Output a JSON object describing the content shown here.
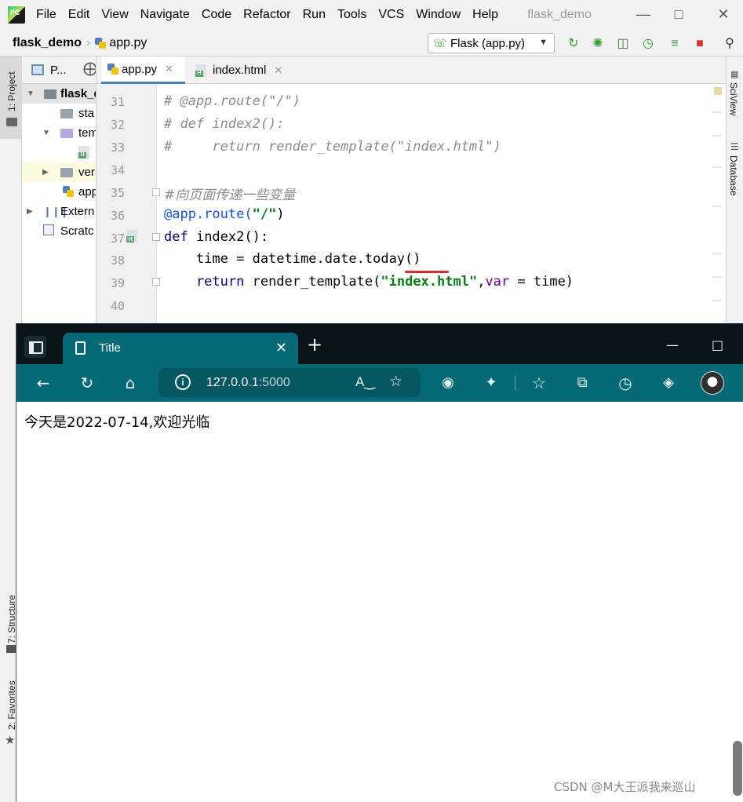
{
  "ide": {
    "menu": [
      "File",
      "Edit",
      "View",
      "Navigate",
      "Code",
      "Refactor",
      "Run",
      "Tools",
      "VCS",
      "Window",
      "Help"
    ],
    "window_title": "flask_demo",
    "breadcrumb": {
      "project": "flask_demo",
      "file": "app.py"
    },
    "run_config": "Flask (app.py)",
    "left_strip": {
      "project": "1: Project",
      "structure": "7: Structure",
      "favorites": "2: Favorites"
    },
    "right_strip": {
      "sciview": "SciView",
      "database": "Database"
    },
    "project_panel": {
      "header": "P...",
      "tree": [
        "flask_d",
        "sta",
        "tem",
        "",
        "ver",
        "app",
        "Extern",
        "Scratc"
      ]
    },
    "tabs": [
      {
        "label": "app.py",
        "active": true
      },
      {
        "label": "index.html",
        "active": false
      }
    ],
    "code": {
      "line_numbers": [
        "31",
        "32",
        "33",
        "34",
        "35",
        "36",
        "37",
        "38",
        "39",
        "40"
      ],
      "l31": "# @app.route(\"/\")",
      "l32": "# def index2():",
      "l33": "#     return render_template(\"index.html\")",
      "l35": "#向页面传递一些变量",
      "l36a": "@app.route(",
      "l36b": "\"/\"",
      "l36c": ")",
      "l37a": "def",
      "l37b": " index2():",
      "l38": "    time = datetime.date.today()",
      "l39a": "    return",
      "l39b": " render_template(",
      "l39c": "\"index.html\"",
      "l39d": ",",
      "l39e": "var",
      "l39f": " = time)"
    }
  },
  "browser": {
    "tab_title": "Title",
    "url_host": "127.0.0.1",
    "url_port": ":5000",
    "read_aloud": "Aͅ",
    "page_text": "今天是2022-07-14,欢迎光临"
  },
  "watermark": "CSDN @M大王派我来巡山"
}
